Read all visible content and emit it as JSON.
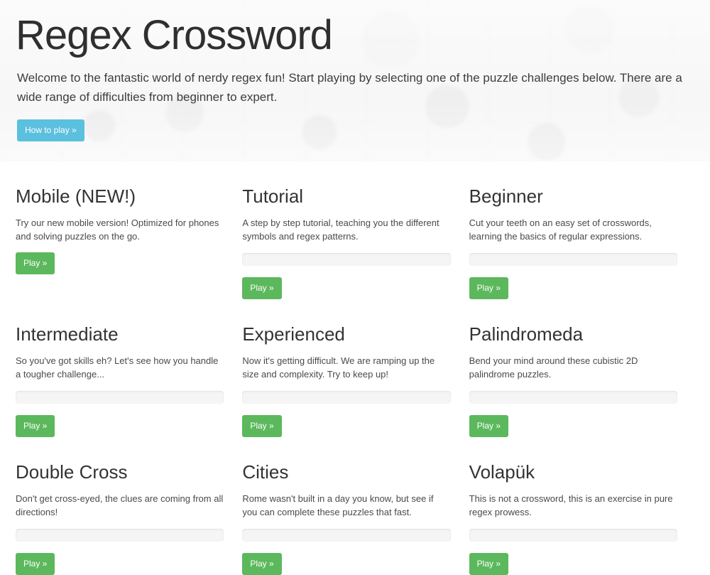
{
  "header": {
    "title": "Regex Crossword",
    "lead": "Welcome to the fantastic world of nerdy regex fun! Start playing by selecting one of the puzzle challenges below. There are a wide range of difficulties from beginner to expert.",
    "how_to_play_label": "How to play »"
  },
  "colors": {
    "info_button": "#5bc0de",
    "success_button": "#5cb85c",
    "progress_track": "#f5f5f5",
    "jumbotron_bg": "#f7f7f7",
    "heading_text": "#333333"
  },
  "play_label": "Play »",
  "puzzles": [
    {
      "title": "Mobile (NEW!)",
      "description": "Try our new mobile version! Optimized for phones and solving puzzles on the go.",
      "has_progress": false,
      "progress_percent": 0,
      "play_label": "Play »"
    },
    {
      "title": "Tutorial",
      "description": "A step by step tutorial, teaching you the different symbols and regex patterns.",
      "has_progress": true,
      "progress_percent": 0,
      "play_label": "Play »"
    },
    {
      "title": "Beginner",
      "description": "Cut your teeth on an easy set of crosswords, learning the basics of regular expressions.",
      "has_progress": true,
      "progress_percent": 0,
      "play_label": "Play »"
    },
    {
      "title": "Intermediate",
      "description": "So you've got skills eh? Let's see how you handle a tougher challenge...",
      "has_progress": true,
      "progress_percent": 0,
      "play_label": "Play »"
    },
    {
      "title": "Experienced",
      "description": "Now it's getting difficult. We are ramping up the size and complexity. Try to keep up!",
      "has_progress": true,
      "progress_percent": 0,
      "play_label": "Play »"
    },
    {
      "title": "Palindromeda",
      "description": "Bend your mind around these cubistic 2D palindrome puzzles.",
      "has_progress": true,
      "progress_percent": 0,
      "play_label": "Play »"
    },
    {
      "title": "Double Cross",
      "description": "Don't get cross-eyed, the clues are coming from all directions!",
      "has_progress": true,
      "progress_percent": 0,
      "play_label": "Play »"
    },
    {
      "title": "Cities",
      "description": "Rome wasn't built in a day you know, but see if you can complete these puzzles that fast.",
      "has_progress": true,
      "progress_percent": 0,
      "play_label": "Play »"
    },
    {
      "title": "Volapük",
      "description": "This is not a crossword, this is an exercise in pure regex prowess.",
      "has_progress": true,
      "progress_percent": 0,
      "play_label": "Play »"
    }
  ]
}
